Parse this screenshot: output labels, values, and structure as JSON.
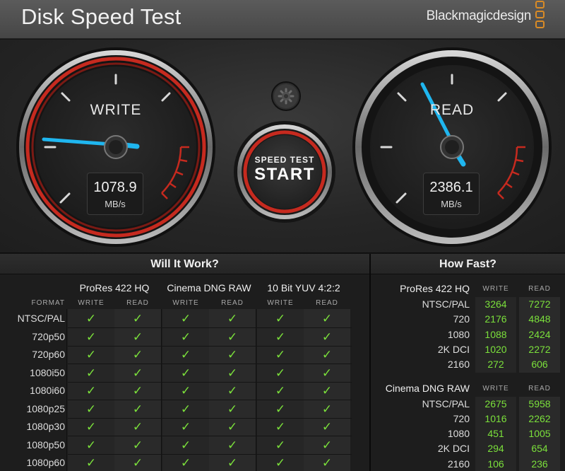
{
  "app": {
    "title": "Disk Speed Test",
    "brand": "Blackmagicdesign"
  },
  "colors": {
    "accent_green": "#7be03b",
    "needle": "#1fb6ef",
    "ring_red": "#c62a1f",
    "brand_orange": "#d98b26"
  },
  "write_gauge": {
    "title": "WRITE",
    "value": "1078.9",
    "unit": "MB/s"
  },
  "read_gauge": {
    "title": "READ",
    "value": "2386.1",
    "unit": "MB/s"
  },
  "start_button": {
    "line1": "SPEED TEST",
    "line2": "START"
  },
  "settings_icon": "gear-icon",
  "will_it_work": {
    "header": "Will It Work?",
    "format_label": "FORMAT",
    "write_label": "WRITE",
    "read_label": "READ",
    "codecs": [
      "ProRes 422 HQ",
      "Cinema DNG RAW",
      "10 Bit YUV 4:2:2"
    ],
    "formats": [
      "NTSC/PAL",
      "720p50",
      "720p60",
      "1080i50",
      "1080i60",
      "1080p25",
      "1080p30",
      "1080p50",
      "1080p60"
    ],
    "check_glyph": "✓"
  },
  "how_fast": {
    "header": "How Fast?",
    "write_label": "WRITE",
    "read_label": "READ",
    "sections": [
      {
        "title": "ProRes 422 HQ",
        "rows": [
          {
            "label": "NTSC/PAL",
            "write": "3264",
            "read": "7272"
          },
          {
            "label": "720",
            "write": "2176",
            "read": "4848"
          },
          {
            "label": "1080",
            "write": "1088",
            "read": "2424"
          },
          {
            "label": "2K DCI",
            "write": "1020",
            "read": "2272"
          },
          {
            "label": "2160",
            "write": "272",
            "read": "606"
          }
        ]
      },
      {
        "title": "Cinema DNG RAW",
        "rows": [
          {
            "label": "NTSC/PAL",
            "write": "2675",
            "read": "5958"
          },
          {
            "label": "720",
            "write": "1016",
            "read": "2262"
          },
          {
            "label": "1080",
            "write": "451",
            "read": "1005"
          },
          {
            "label": "2K DCI",
            "write": "294",
            "read": "654"
          },
          {
            "label": "2160",
            "write": "106",
            "read": "236"
          }
        ]
      }
    ]
  }
}
